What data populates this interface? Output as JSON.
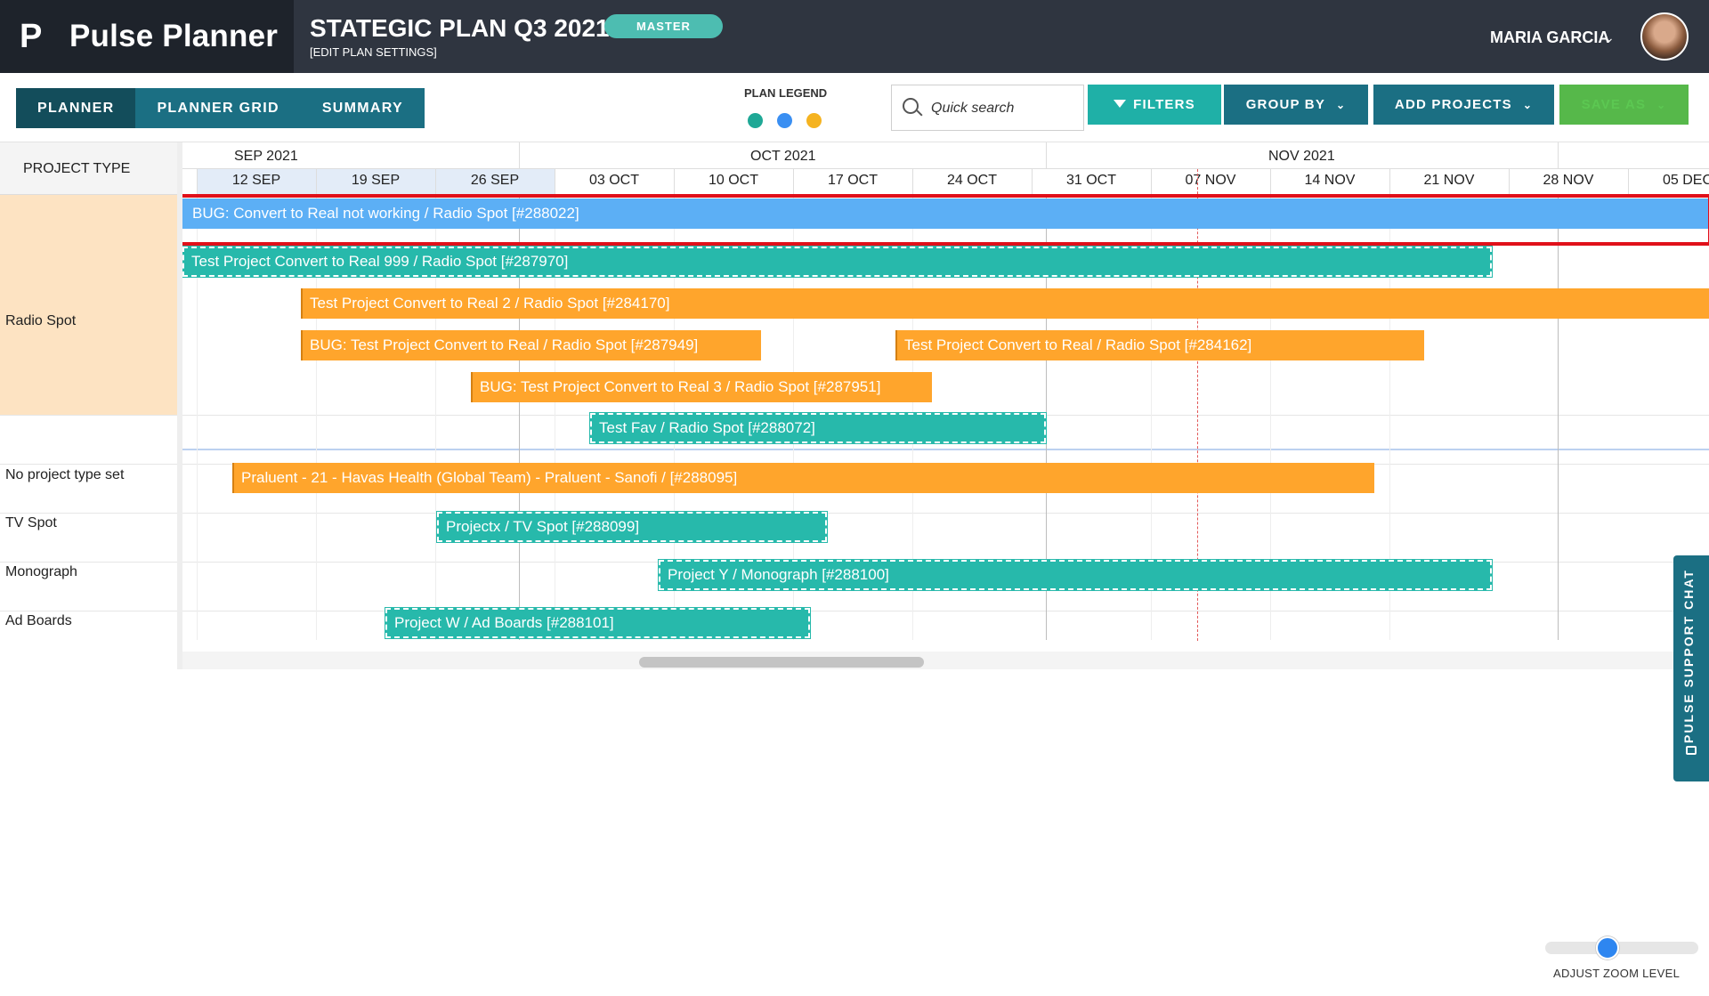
{
  "app": {
    "brand_name": "Pulse Planner",
    "logo_letter": "P"
  },
  "header": {
    "plan_title": "STATEGIC PLAN Q3 2021",
    "plan_settings": "[EDIT PLAN SETTINGS]",
    "badge": "MASTER",
    "user_name": "MARIA GARCIA"
  },
  "toolbar": {
    "tabs": [
      {
        "label": "PLANNER",
        "active": true
      },
      {
        "label": "PLANNER GRID",
        "active": false
      },
      {
        "label": "SUMMARY",
        "active": false
      }
    ],
    "legend_label": "PLAN LEGEND",
    "legend_colors": [
      "#1fa896",
      "#3a8ff2",
      "#f5b320"
    ],
    "search_placeholder": "Quick search",
    "filters_label": "FILTERS",
    "group_by_label": "GROUP BY",
    "add_projects_label": "ADD PROJECTS",
    "save_as_label": "SAVE AS"
  },
  "gantt": {
    "column_header": "PROJECT TYPE",
    "months": [
      "SEP 2021",
      "OCT 2021",
      "NOV 2021"
    ],
    "weeks": [
      "12 SEP",
      "19 SEP",
      "26 SEP",
      "03 OCT",
      "10 OCT",
      "17 OCT",
      "24 OCT",
      "31 OCT",
      "07 NOV",
      "14 NOV",
      "21 NOV",
      "28 NOV",
      "05 DEC"
    ],
    "rows": [
      {
        "label": "Radio Spot"
      },
      {
        "label": "No project type set"
      },
      {
        "label": "TV Spot"
      },
      {
        "label": "Monograph"
      },
      {
        "label": "Ad Boards"
      }
    ],
    "bars": [
      {
        "label": "BUG: Convert to Real not working / Radio Spot [#288022]",
        "color": "blue",
        "highlighted": true
      },
      {
        "label": "Test Project Convert to Real 999 / Radio Spot [#287970]",
        "color": "teal"
      },
      {
        "label": "Test Project Convert to Real 2 / Radio Spot [#284170]",
        "color": "orange"
      },
      {
        "label": "BUG: Test Project Convert to Real / Radio Spot [#287949]",
        "color": "orange"
      },
      {
        "label": "Test Project Convert to Real / Radio Spot [#284162]",
        "color": "orange"
      },
      {
        "label": "BUG: Test Project Convert to Real 3 / Radio Spot [#287951]",
        "color": "orange"
      },
      {
        "label": "Test Fav / Radio Spot [#288072]",
        "color": "teal"
      },
      {
        "label": "Praluent - 21 - Havas Health (Global Team) - Praluent - Sanofi / [#288095]",
        "color": "orange"
      },
      {
        "label": "Projectx / TV Spot [#288099]",
        "color": "teal"
      },
      {
        "label": "Project Y / Monograph [#288100]",
        "color": "teal"
      },
      {
        "label": "Project W / Ad Boards [#288101]",
        "color": "teal"
      }
    ]
  },
  "chat": {
    "label": "PULSE SUPPORT CHAT"
  },
  "zoom": {
    "label": "ADJUST ZOOM LEVEL",
    "level": 0.35
  }
}
